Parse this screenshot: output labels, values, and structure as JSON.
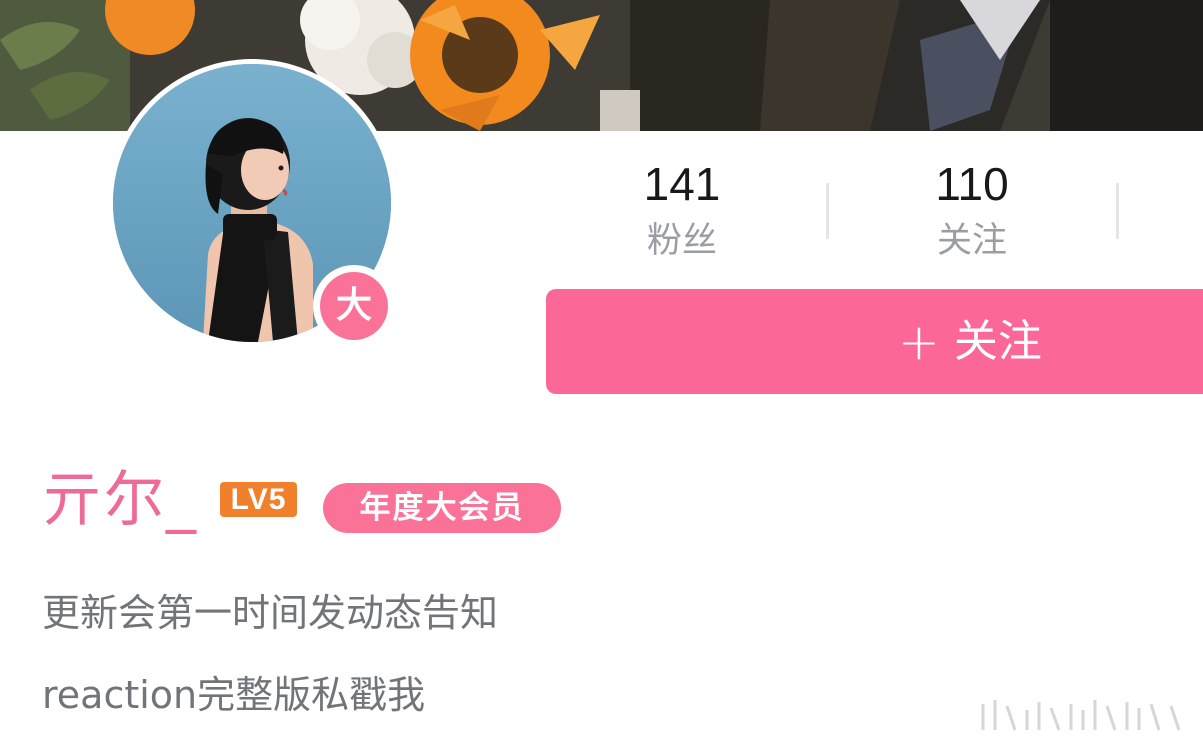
{
  "stats": {
    "fans_count": "141",
    "fans_label": "粉丝",
    "following_count": "110",
    "following_label": "关注"
  },
  "follow_button": {
    "plus": "+",
    "label": "关注"
  },
  "avatar": {
    "badge_text": "大"
  },
  "profile": {
    "username": "亓尔_",
    "level": "LV5",
    "vip_tag": "年度大会员",
    "bio_lines": [
      "更新会第一时间发动态告知",
      "reaction完整版私戳我"
    ]
  },
  "colors": {
    "accent_pink": "#fb7299",
    "username_pink": "#ee6a97",
    "level_orange": "#f0802c"
  },
  "icons": {
    "avatar_badge": "vip-badge-icon",
    "follow_plus": "plus-icon",
    "watermark": "watermark-logo"
  }
}
